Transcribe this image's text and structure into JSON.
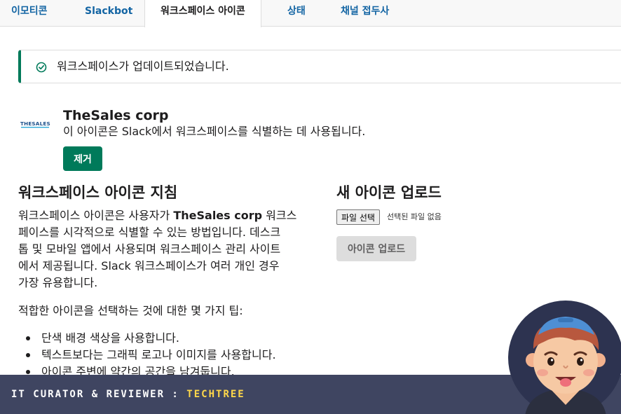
{
  "tabs": [
    {
      "label": "이모티콘"
    },
    {
      "label": "Slackbot"
    },
    {
      "label": "워크스페이스 아이콘",
      "active": true
    },
    {
      "label": "상태"
    },
    {
      "label": "채널 접두사"
    }
  ],
  "alert": {
    "message": "워크스페이스가 업데이트되었습니다.",
    "icon": "check-circle-icon",
    "color": "#007a5a"
  },
  "workspace": {
    "logo_text": "THESALES",
    "name": "TheSales corp",
    "description": "이 아이콘은 Slack에서 워크스페이스를 식별하는 데 사용됩니다.",
    "remove_label": "제거"
  },
  "guidelines": {
    "title": "워크스페이스 아이콘 지침",
    "body_lines": [
      "워크스페이스 아이콘은 사용자가 TheSales corp 워크스",
      "페이스를 시각적으로 식별할 수 있는 방법입니다. 데스크",
      "톱 및 모바일 앱에서 사용되며 워크스페이스 관리 사이트",
      "에서 제공됩니다. Slack 워크스페이스가 여러 개인 경우",
      "가장 유용합니다."
    ],
    "tips_intro": "적합한 아이콘을 선택하는 것에 대한 몇 가지 팁:",
    "tips": [
      "단색 배경 색상을 사용합니다.",
      "텍스트보다는 그래픽 로고나 이미지를 사용합니다.",
      "아이콘 주변에 약간의 공간을 남겨둡니다."
    ]
  },
  "upload": {
    "title": "새 아이콘 업로드",
    "file_button": "파일 선택",
    "file_status": "선택된 파일 없음",
    "upload_label": "아이콘 업로드"
  },
  "banner": {
    "text": "IT CURATOR & REVIEWER : ",
    "accent": "TECHTREE",
    "accent_color": "#ffd84a"
  },
  "colors": {
    "link": "#1264a3",
    "primary": "#007a5a",
    "banner_bg": "#3f4561"
  }
}
